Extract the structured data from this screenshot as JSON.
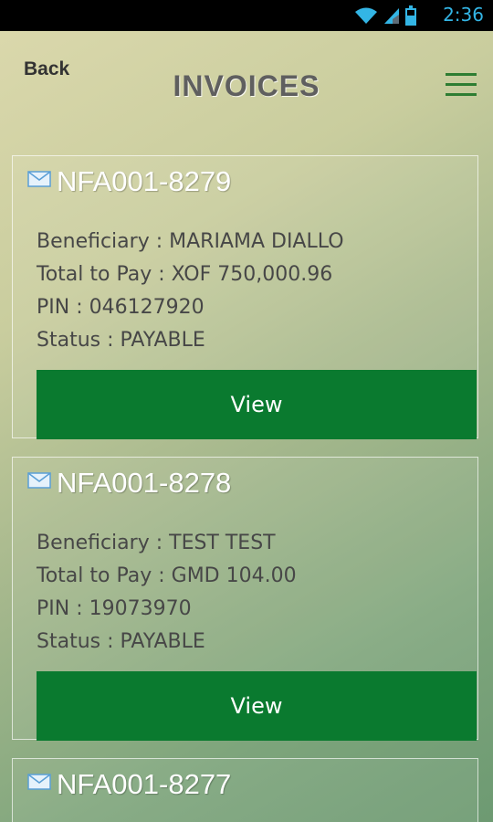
{
  "status_bar": {
    "time": "2:36"
  },
  "header": {
    "back_label": "Back",
    "title": "INVOICES"
  },
  "labels": {
    "beneficiary": "Beneficiary",
    "total_to_pay": "Total to Pay",
    "pin": "PIN",
    "status": "Status",
    "separator": " : "
  },
  "invoices": [
    {
      "number": "NFA001-8279",
      "beneficiary": "MARIAMA DIALLO",
      "total": "XOF 750,000.96",
      "pin": "046127920",
      "status": "PAYABLE",
      "action": "View"
    },
    {
      "number": "NFA001-8278",
      "beneficiary": "TEST TEST",
      "total": "GMD 104.00",
      "pin": "19073970",
      "status": "PAYABLE",
      "action": "View"
    },
    {
      "number": "NFA001-8277"
    }
  ],
  "icons": {
    "wifi": "wifi-icon",
    "signal": "signal-icon",
    "battery": "battery-icon",
    "menu": "hamburger-menu-icon",
    "mail": "envelope-icon"
  },
  "colors": {
    "accent_green": "#0a7a2f",
    "time_blue": "#33b5e5"
  }
}
